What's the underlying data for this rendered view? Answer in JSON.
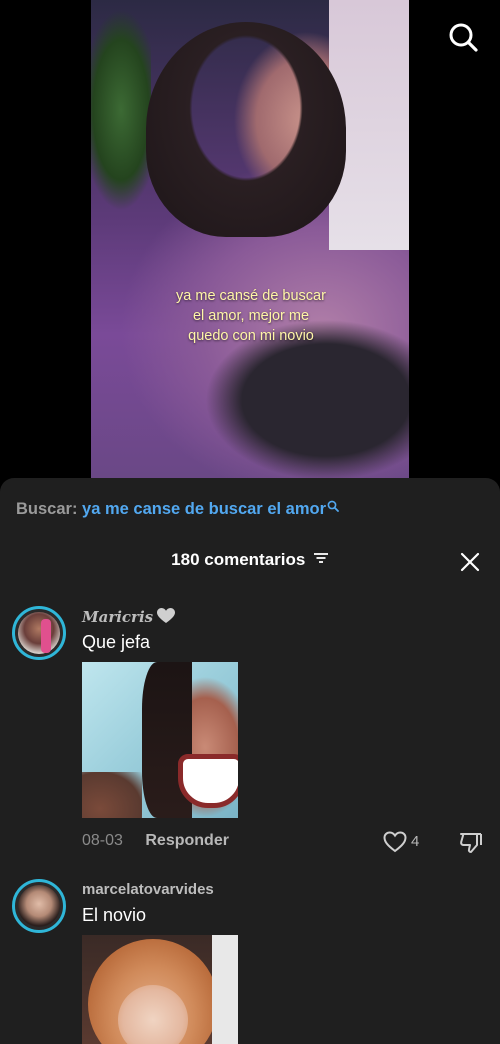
{
  "video": {
    "caption": "ya me cansé de buscar\nel amor, mejor me\nquedo con mi novio",
    "search_icon": "search-icon"
  },
  "panel": {
    "search_prefix": "Buscar:",
    "search_query": "ya me canse de buscar el amor",
    "comments_count": "180 comentarios",
    "filter_icon": "filter-icon",
    "close_icon": "close-icon"
  },
  "comments": [
    {
      "username": "Maricris",
      "text": "Que jefa",
      "date": "08-03",
      "reply_label": "Responder",
      "likes": "4"
    },
    {
      "username": "marcelatovarvides",
      "text": "El novio"
    }
  ],
  "colors": {
    "panel_bg": "#1f1f1f",
    "query_blue": "#52a8f0",
    "avatar_ring": "#2fb6d8",
    "caption_yellow": "#fff6a8"
  }
}
